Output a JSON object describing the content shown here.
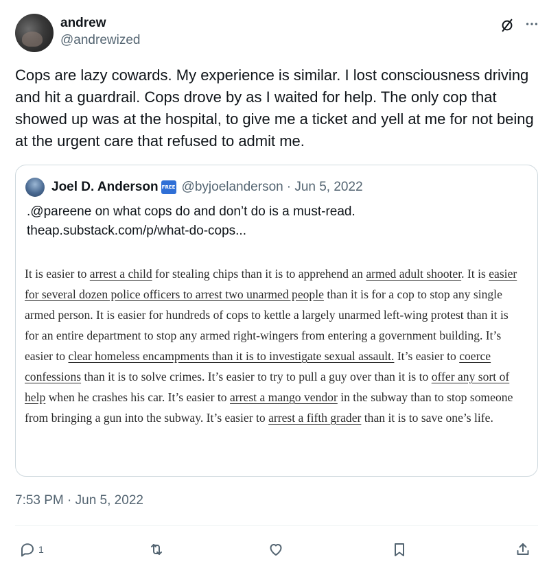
{
  "author": {
    "display_name": "andrew",
    "handle": "@andrewized"
  },
  "tweet": {
    "text": "Cops are lazy cowards. My experience is similar. I lost consciousness driving and hit a guardrail. Cops drove by as I waited for help. The only cop that showed up was at the hospital, to give me a ticket and yell at me for not being at the urgent care that refused to admit me.",
    "timestamp": "7:53 PM · Jun 5, 2022"
  },
  "quote": {
    "display_name": "Joel D. Anderson",
    "badge": "FREE",
    "handle": "@byjoelanderson",
    "date": "· Jun 5, 2022",
    "line1": ".@pareene on what cops do and don’t do is a must-read.",
    "line2": "theap.substack.com/p/what-do-cops...",
    "excerpt": {
      "s1": "It is easier to ",
      "l1": "arrest a child",
      "s2": " for stealing chips than it is to apprehend an ",
      "l2": "armed adult shooter",
      "s3": ". It is ",
      "l3": "easier for several dozen police officers to arrest two unarmed people",
      "s4": " than it is for a cop to stop any single armed person. It is easier for hundreds of cops to kettle a largely unarmed left-wing protest than it is for an entire department to stop any armed right-wingers from entering a government building. It’s easier to ",
      "l4": "clear homeless encampments than it is to investigate sexual assault.",
      "s5": " It’s easier to ",
      "l5": "coerce confessions",
      "s6": " than it is to solve crimes. It’s easier to try to pull a guy over than it is to ",
      "l6": "offer any sort of help",
      "s7": " when he crashes his car. It’s easier to ",
      "l7": "arrest a mango vendor",
      "s8": " in the subway than to stop someone from bringing a gun into the subway. It’s easier to ",
      "l8": "arrest a fifth grader",
      "s9": " than it is to save one’s life."
    }
  },
  "actions": {
    "reply_count": "1",
    "icons": [
      "reply-icon",
      "retweet-icon",
      "like-icon",
      "bookmark-icon",
      "share-icon"
    ]
  },
  "colors": {
    "text": "#0f1419",
    "secondary": "#536471",
    "border": "#cfd9de",
    "badge": "#2f6fd6"
  }
}
